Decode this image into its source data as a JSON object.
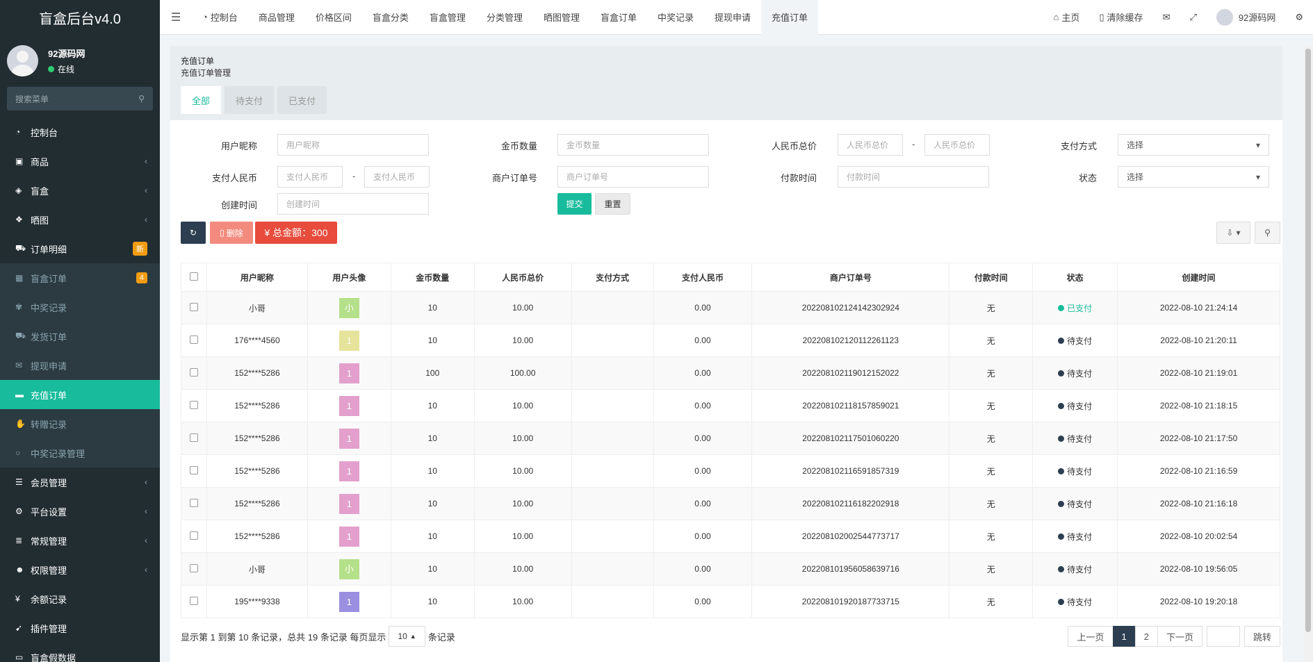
{
  "brand": {
    "title": "盲盒后台v4.0"
  },
  "user": {
    "name": "92源码网",
    "status": "在线"
  },
  "sidebar": {
    "search_placeholder": "搜索菜单",
    "items": [
      {
        "label": "控制台",
        "icon": "dashboard-icon"
      },
      {
        "label": "商品",
        "icon": "shopping-bag-icon"
      },
      {
        "label": "盲盒",
        "icon": "cube-icon"
      },
      {
        "label": "晒图",
        "icon": "dropbox-icon"
      },
      {
        "label": "订单明细",
        "icon": "cart-icon",
        "badge": "新"
      },
      {
        "label": "盲盒订单",
        "icon": "calendar-icon",
        "badge": "4"
      },
      {
        "label": "中奖记录",
        "icon": "gift-icon"
      },
      {
        "label": "发货订单",
        "icon": "truck-icon"
      },
      {
        "label": "提现申请",
        "icon": "comments-icon"
      },
      {
        "label": "充值订单",
        "icon": "credit-card-icon"
      },
      {
        "label": "转赠记录",
        "icon": "handshake-icon"
      },
      {
        "label": "中奖记录管理",
        "icon": "circle-icon"
      },
      {
        "label": "会员管理",
        "icon": "list-icon"
      },
      {
        "label": "平台设置",
        "icon": "gear-icon"
      },
      {
        "label": "常规管理",
        "icon": "database-icon"
      },
      {
        "label": "权限管理",
        "icon": "users-icon"
      },
      {
        "label": "余额记录",
        "icon": "yen-icon"
      },
      {
        "label": "插件管理",
        "icon": "rocket-icon"
      },
      {
        "label": "盲盒假数据",
        "icon": "file-icon"
      }
    ]
  },
  "topnav": {
    "tabs": [
      "控制台",
      "商品管理",
      "价格区间",
      "盲盒分类",
      "盲盒管理",
      "分类管理",
      "晒图管理",
      "盲盒订单",
      "中奖记录",
      "提现申请",
      "充值订单"
    ],
    "home": "主页",
    "clear_cache": "清除缓存",
    "username": "92源码网"
  },
  "panel": {
    "title": "充值订单",
    "subtitle": "充值订单管理",
    "subtabs": [
      "全部",
      "待支付",
      "已支付"
    ]
  },
  "form": {
    "nickname": {
      "label": "用户昵称",
      "placeholder": "用户昵称"
    },
    "coin": {
      "label": "金币数量",
      "placeholder": "金币数量"
    },
    "rmb_total": {
      "label": "人民币总价",
      "placeholder": "人民币总价"
    },
    "pay_method": {
      "label": "支付方式",
      "value": "选择"
    },
    "pay_rmb": {
      "label": "支付人民币",
      "placeholder": "支付人民币"
    },
    "order_no": {
      "label": "商户订单号",
      "placeholder": "商户订单号"
    },
    "pay_time": {
      "label": "付款时间",
      "placeholder": "付款时间"
    },
    "status": {
      "label": "状态",
      "value": "选择"
    },
    "create_time": {
      "label": "创建时间",
      "placeholder": "创建时间"
    },
    "submit": "提交",
    "reset": "重置"
  },
  "toolbar": {
    "delete": "删除",
    "total": "¥ 总金额：300"
  },
  "table": {
    "headers": [
      "用户昵称",
      "用户头像",
      "金币数量",
      "人民币总价",
      "支付方式",
      "支付人民币",
      "商户订单号",
      "付款时间",
      "状态",
      "创建时间"
    ],
    "rows": [
      {
        "nickname": "小哥",
        "avatar": "小",
        "avatar_color": "#b5e08a",
        "coin": "10",
        "rmb": "10.00",
        "method": "",
        "paid": "0.00",
        "order": "20220810212414230292​4",
        "pay_time": "无",
        "status": "已支付",
        "status_type": "paid",
        "created": "2022-08-10 21:24:14"
      },
      {
        "nickname": "176****4560",
        "avatar": "1",
        "avatar_color": "#e6e39a",
        "coin": "10",
        "rmb": "10.00",
        "method": "",
        "paid": "0.00",
        "order": "20220810212011226112​3",
        "pay_time": "无",
        "status": "待支付",
        "status_type": "pending",
        "created": "2022-08-10 21:20:11"
      },
      {
        "nickname": "152****5286",
        "avatar": "1",
        "avatar_color": "#e3a0cc",
        "coin": "100",
        "rmb": "100.00",
        "method": "",
        "paid": "0.00",
        "order": "20220810211901215202​2",
        "pay_time": "无",
        "status": "待支付",
        "status_type": "pending",
        "created": "2022-08-10 21:19:01"
      },
      {
        "nickname": "152****5286",
        "avatar": "1",
        "avatar_color": "#e3a0cc",
        "coin": "10",
        "rmb": "10.00",
        "method": "",
        "paid": "0.00",
        "order": "20220810211815785902​1",
        "pay_time": "无",
        "status": "待支付",
        "status_type": "pending",
        "created": "2022-08-10 21:18:15"
      },
      {
        "nickname": "152****5286",
        "avatar": "1",
        "avatar_color": "#e3a0cc",
        "coin": "10",
        "rmb": "10.00",
        "method": "",
        "paid": "0.00",
        "order": "20220810211750106022​0",
        "pay_time": "无",
        "status": "待支付",
        "status_type": "pending",
        "created": "2022-08-10 21:17:50"
      },
      {
        "nickname": "152****5286",
        "avatar": "1",
        "avatar_color": "#e3a0cc",
        "coin": "10",
        "rmb": "10.00",
        "method": "",
        "paid": "0.00",
        "order": "20220810211659185731​9",
        "pay_time": "无",
        "status": "待支付",
        "status_type": "pending",
        "created": "2022-08-10 21:16:59"
      },
      {
        "nickname": "152****5286",
        "avatar": "1",
        "avatar_color": "#e3a0cc",
        "coin": "10",
        "rmb": "10.00",
        "method": "",
        "paid": "0.00",
        "order": "20220810211618220291​8",
        "pay_time": "无",
        "status": "待支付",
        "status_type": "pending",
        "created": "2022-08-10 21:16:18"
      },
      {
        "nickname": "152****5286",
        "avatar": "1",
        "avatar_color": "#e3a0cc",
        "coin": "10",
        "rmb": "10.00",
        "method": "",
        "paid": "0.00",
        "order": "20220810200254477371​7",
        "pay_time": "无",
        "status": "待支付",
        "status_type": "pending",
        "created": "2022-08-10 20:02:54"
      },
      {
        "nickname": "小哥",
        "avatar": "小",
        "avatar_color": "#b5e08a",
        "coin": "10",
        "rmb": "10.00",
        "method": "",
        "paid": "0.00",
        "order": "20220810195605863971​6",
        "pay_time": "无",
        "status": "待支付",
        "status_type": "pending",
        "created": "2022-08-10 19:56:05"
      },
      {
        "nickname": "195****9338",
        "avatar": "1",
        "avatar_color": "#9a8fe0",
        "coin": "10",
        "rmb": "10.00",
        "method": "",
        "paid": "0.00",
        "order": "20220810192018773371​5",
        "pay_time": "无",
        "status": "待支付",
        "status_type": "pending",
        "created": "2022-08-10 19:20:18"
      }
    ]
  },
  "footer": {
    "summary_prefix": "显示第 1 到第 10 条记录，总共 19 条记录 每页显示",
    "page_size": "10",
    "summary_suffix": "条记录",
    "prev": "上一页",
    "pages": [
      "1",
      "2"
    ],
    "next": "下一页",
    "jump": "跳转"
  }
}
